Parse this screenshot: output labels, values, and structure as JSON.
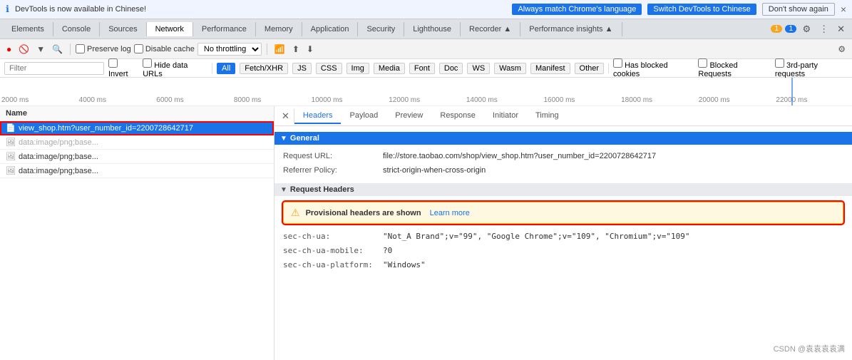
{
  "infobar": {
    "icon": "ℹ",
    "text": "DevTools is now available in Chinese!",
    "btn1": "Always match Chrome's language",
    "btn2": "Switch DevTools to Chinese",
    "btn3": "Don't show again",
    "close": "×"
  },
  "tabs": {
    "items": [
      "Elements",
      "Console",
      "Sources",
      "Network",
      "Performance",
      "Memory",
      "Application",
      "Security",
      "Lighthouse",
      "Recorder ▲",
      "Performance insights ▲"
    ],
    "active": "Network",
    "badge_warn": "1",
    "badge_info": "1"
  },
  "toolbar": {
    "preserve_log": "Preserve log",
    "disable_cache": "Disable cache",
    "no_throttling": "No throttling",
    "online_icon": "▾"
  },
  "filter": {
    "placeholder": "Filter",
    "invert": "Invert",
    "hide_data_urls": "Hide data URLs",
    "all": "All",
    "fetch_xhr": "Fetch/XHR",
    "js": "JS",
    "css": "CSS",
    "img": "Img",
    "media": "Media",
    "font": "Font",
    "doc": "Doc",
    "ws": "WS",
    "wasm": "Wasm",
    "manifest": "Manifest",
    "other": "Other",
    "blocked_cookies": "Has blocked cookies",
    "blocked_requests": "Blocked Requests",
    "third_party": "3rd-party requests"
  },
  "timeline": {
    "labels": [
      "2000 ms",
      "4000 ms",
      "6000 ms",
      "8000 ms",
      "10000 ms",
      "12000 ms",
      "14000 ms",
      "16000 ms",
      "18000 ms",
      "20000 ms",
      "22000 ms"
    ]
  },
  "file_list": {
    "header": "Name",
    "items": [
      {
        "name": "view_shop.htm?user_number_id=2200728642717",
        "selected": true,
        "icon": "📄"
      },
      {
        "name": "data:image/png;base...",
        "selected": false,
        "icon": "🖼",
        "dimmed": true
      },
      {
        "name": "data:image/png;base...",
        "selected": false,
        "icon": "🖼"
      },
      {
        "name": "data:image/png;base...",
        "selected": false,
        "icon": "🖼"
      }
    ]
  },
  "detail": {
    "sub_tabs": [
      "Headers",
      "Payload",
      "Preview",
      "Response",
      "Initiator",
      "Timing"
    ],
    "active_tab": "Headers",
    "general": {
      "title": "General",
      "request_url_label": "Request URL:",
      "request_url_value": "file://store.taobao.com/shop/view_shop.htm?user_number_id=2200728642717",
      "referrer_policy_label": "Referrer Policy:",
      "referrer_policy_value": "strict-origin-when-cross-origin"
    },
    "request_headers": {
      "title": "Request Headers",
      "warning_text": "Provisional headers are shown",
      "warning_link": "Learn more",
      "rows": [
        {
          "label": "sec-ch-ua:",
          "value": "\"Not_A Brand\";v=\"99\", \"Google Chrome\";v=\"109\", \"Chromium\";v=\"109\""
        },
        {
          "label": "sec-ch-ua-mobile:",
          "value": "?0"
        },
        {
          "label": "sec-ch-ua-platform:",
          "value": "\"Windows\""
        }
      ]
    }
  },
  "watermark": "CSDN @袁袁袁袁满"
}
